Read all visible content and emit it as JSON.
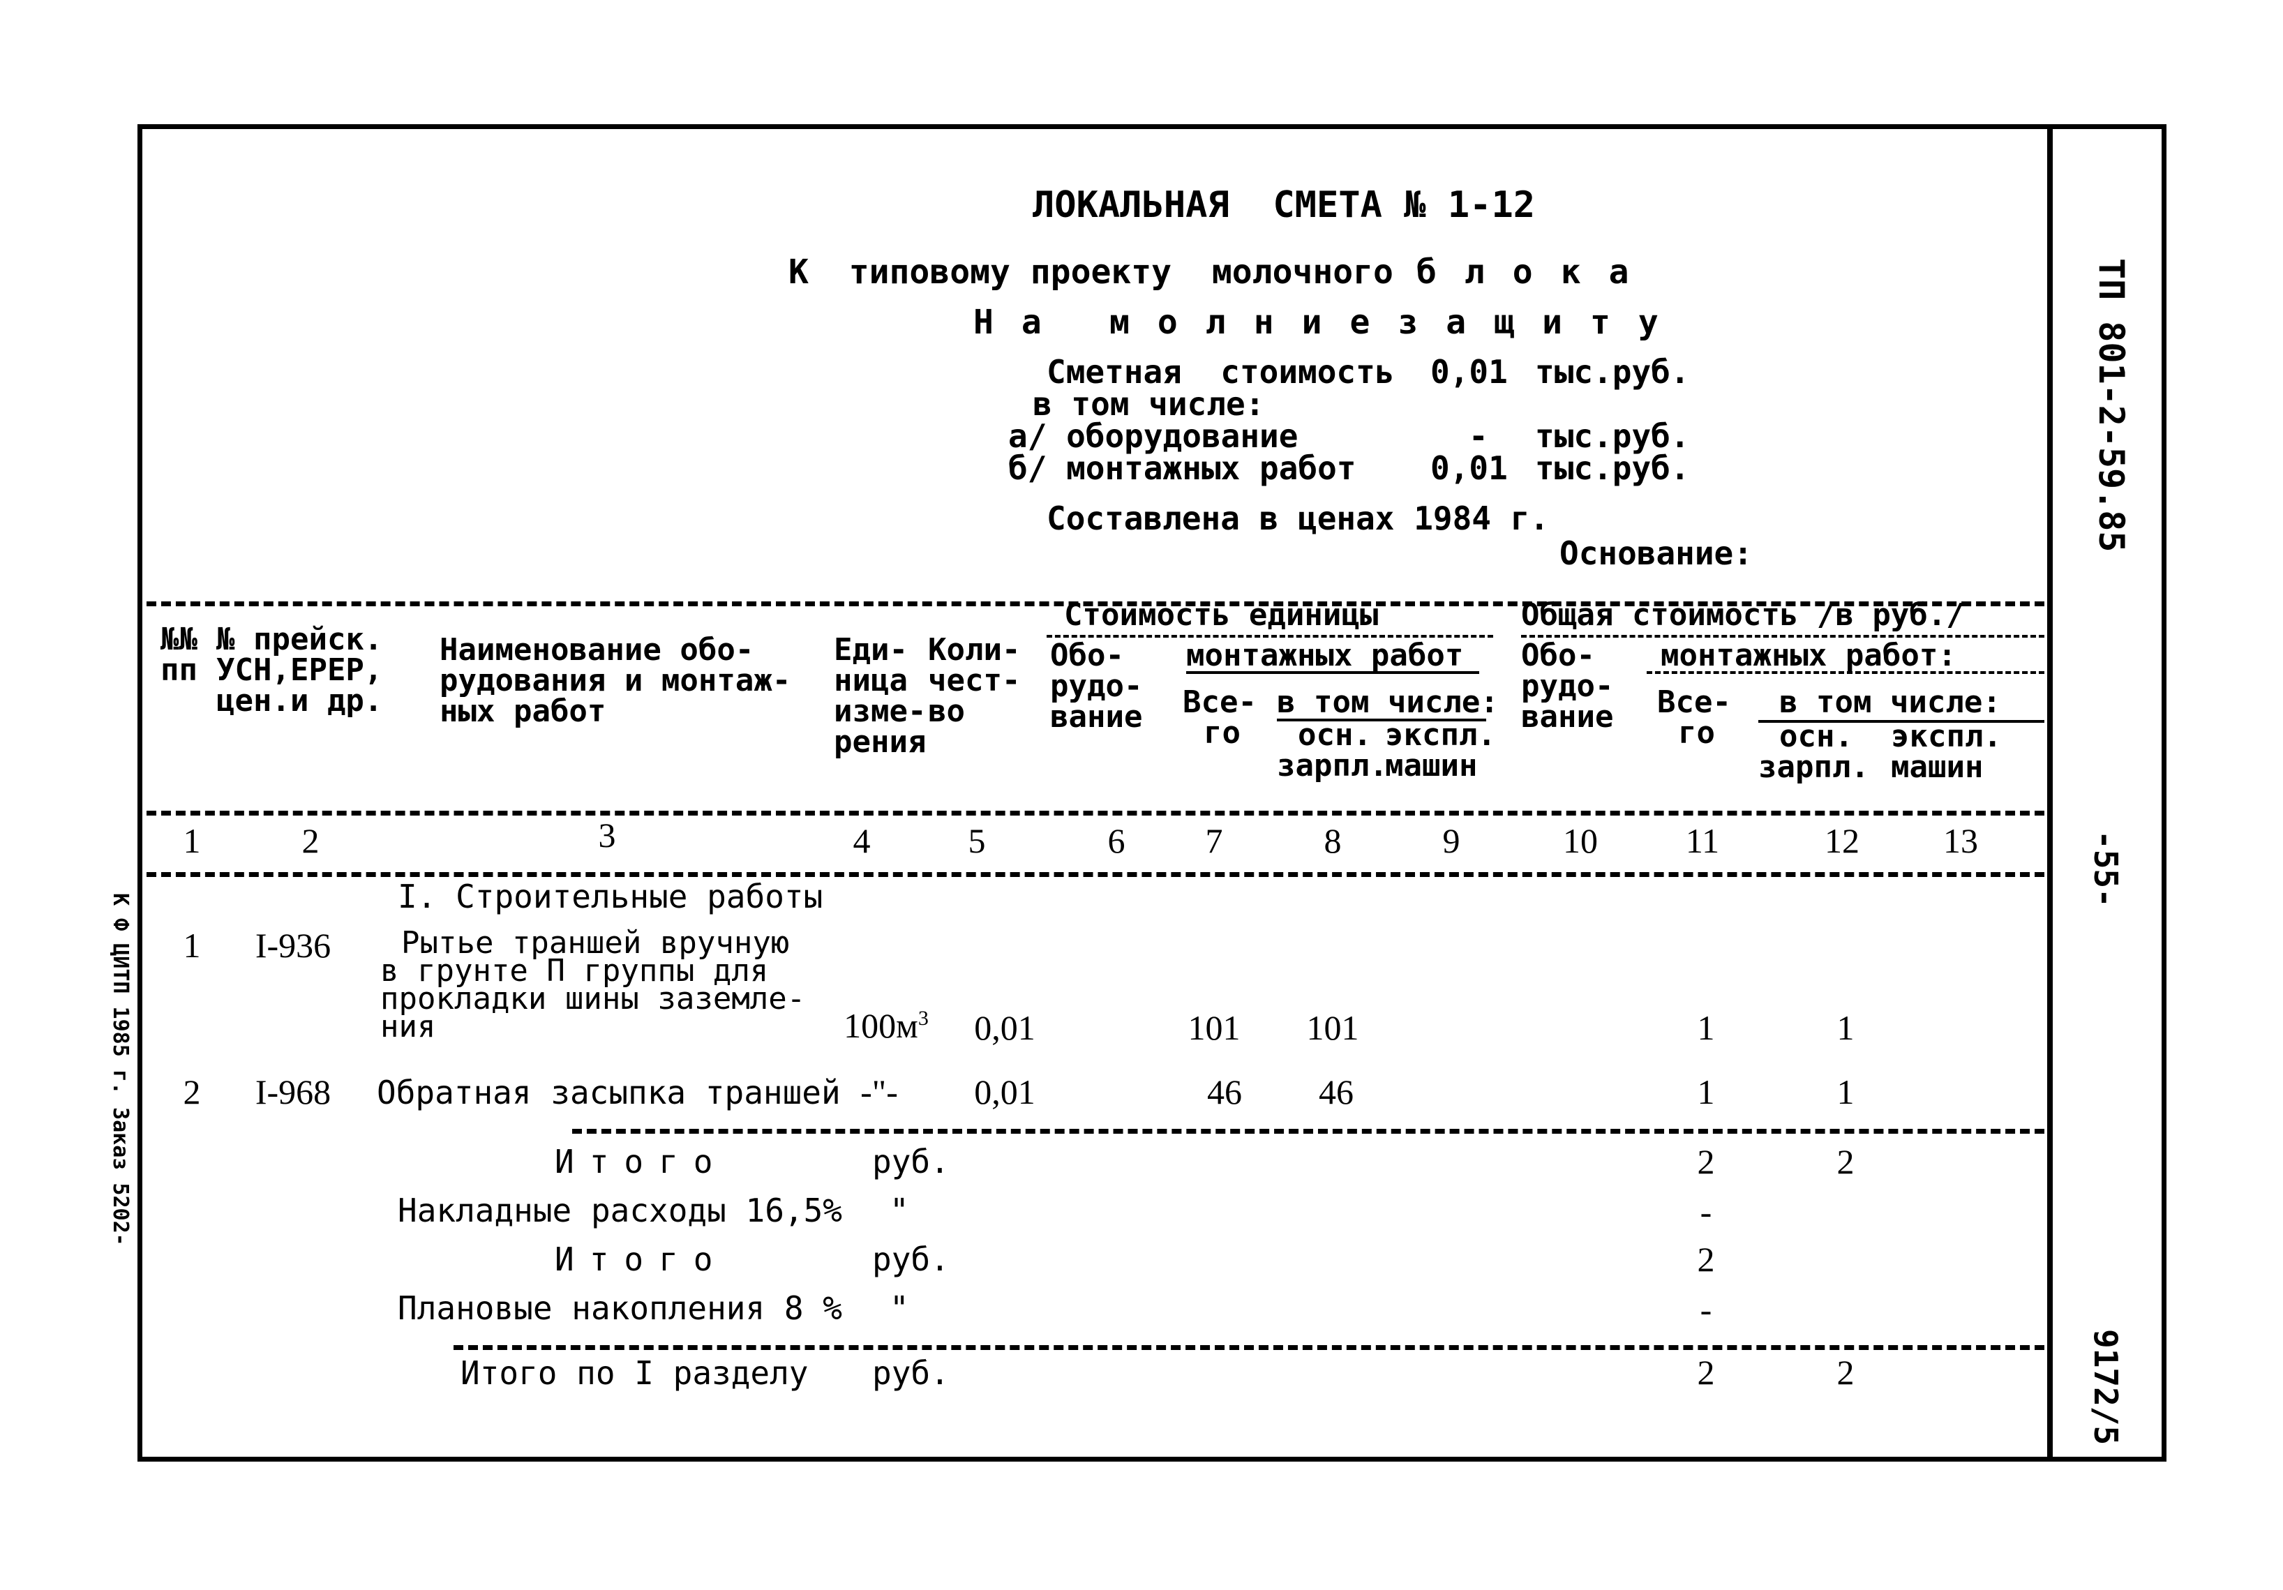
{
  "header": {
    "title": "ЛОКАЛЬНАЯ  СМЕТА № 1-12",
    "subtitle_prefix": "К  типовому проекту  молочного",
    "subtitle_block": "блока",
    "object_prefix": "На",
    "object_name": "молниезащиту",
    "estimated_cost_label": "Сметная  стоимость",
    "estimated_cost_value": "0,01",
    "unit": "тыс.руб.",
    "including_label": "в том числе:",
    "equipment_label": "а/ оборудование",
    "equipment_value": "-",
    "installation_label": "б/ монтажных работ",
    "installation_value": "0,01",
    "prices_note": "Составлена в ценах 1984 г.",
    "basis_label": "Основание:"
  },
  "stamps": {
    "project_code": "ТП 801-2-59.85",
    "page_number": "-55-",
    "sheet_code": "9172/5",
    "printer_note": "К Ф ЦИТП 1985 г. Заказ 5202-"
  },
  "table": {
    "headers": {
      "col1": [
        "№№",
        "пп"
      ],
      "col2": [
        "№ прейск.",
        "УСН,ЕРЕР,",
        "цен.и др."
      ],
      "col3": [
        "Наименование обо-",
        "рудования и монтаж-",
        "ных работ"
      ],
      "col4": [
        "Еди-",
        "ница",
        "изме-",
        "рения"
      ],
      "col5": [
        "Коли-",
        "чест-",
        "во"
      ],
      "unit_cost_group": "Стоимость единицы",
      "col6": [
        "Обо-",
        "рудо-",
        "вание"
      ],
      "unit_install_group": "монтажных работ",
      "col7": [
        "Все-",
        "го"
      ],
      "unit_incl": "в том числе:",
      "col8": [
        "осн.",
        "зарпл."
      ],
      "col9": [
        "экспл.",
        "машин"
      ],
      "total_cost_group": "Общая стоимость /в руб./",
      "col10": [
        "Обо-",
        "рудо-",
        "вание"
      ],
      "total_install_group": "монтажных работ:",
      "col11": [
        "Все-",
        "го"
      ],
      "total_incl": "в том числе:",
      "col12": [
        "осн.",
        "зарпл."
      ],
      "col13": [
        "экспл.",
        "машин"
      ]
    },
    "column_numbers": [
      "1",
      "2",
      "3",
      "4",
      "5",
      "6",
      "7",
      "8",
      "9",
      "10",
      "11",
      "12",
      "13"
    ],
    "section_title": "I. Строительные работы",
    "rows": [
      {
        "num": "1",
        "code": "I-936",
        "name_lines": [
          "Рытье траншей вручную",
          "в грунте П группы для",
          "прокладки шины заземле-",
          "ния"
        ],
        "unit": "100м",
        "unit_sup": "3",
        "qty": "0,01",
        "unit_equipment": "",
        "unit_total": "101",
        "unit_wages": "101",
        "unit_machines": "",
        "total_equipment": "",
        "total": "1",
        "total_wages": "1",
        "total_machines": ""
      },
      {
        "num": "2",
        "code": "I-968",
        "name_lines": [
          "Обратная засыпка траншей"
        ],
        "unit": "-\"-",
        "unit_sup": "",
        "qty": "0,01",
        "unit_equipment": "",
        "unit_total": "46",
        "unit_wages": "46",
        "unit_machines": "",
        "total_equipment": "",
        "total": "1",
        "total_wages": "1",
        "total_machines": ""
      }
    ],
    "summary": [
      {
        "label": "Итого",
        "unit": "руб.",
        "total": "2",
        "wages": "2"
      },
      {
        "label": "Накладные расходы 16,5%",
        "unit": "\"",
        "total": "-",
        "wages": ""
      },
      {
        "label": "Итого",
        "unit": "руб.",
        "total": "2",
        "wages": ""
      },
      {
        "label": "Плановые накопления 8 %",
        "unit": "\"",
        "total": "-",
        "wages": ""
      },
      {
        "label": "Итого по I разделу",
        "unit": "руб.",
        "total": "2",
        "wages": "2"
      }
    ]
  }
}
